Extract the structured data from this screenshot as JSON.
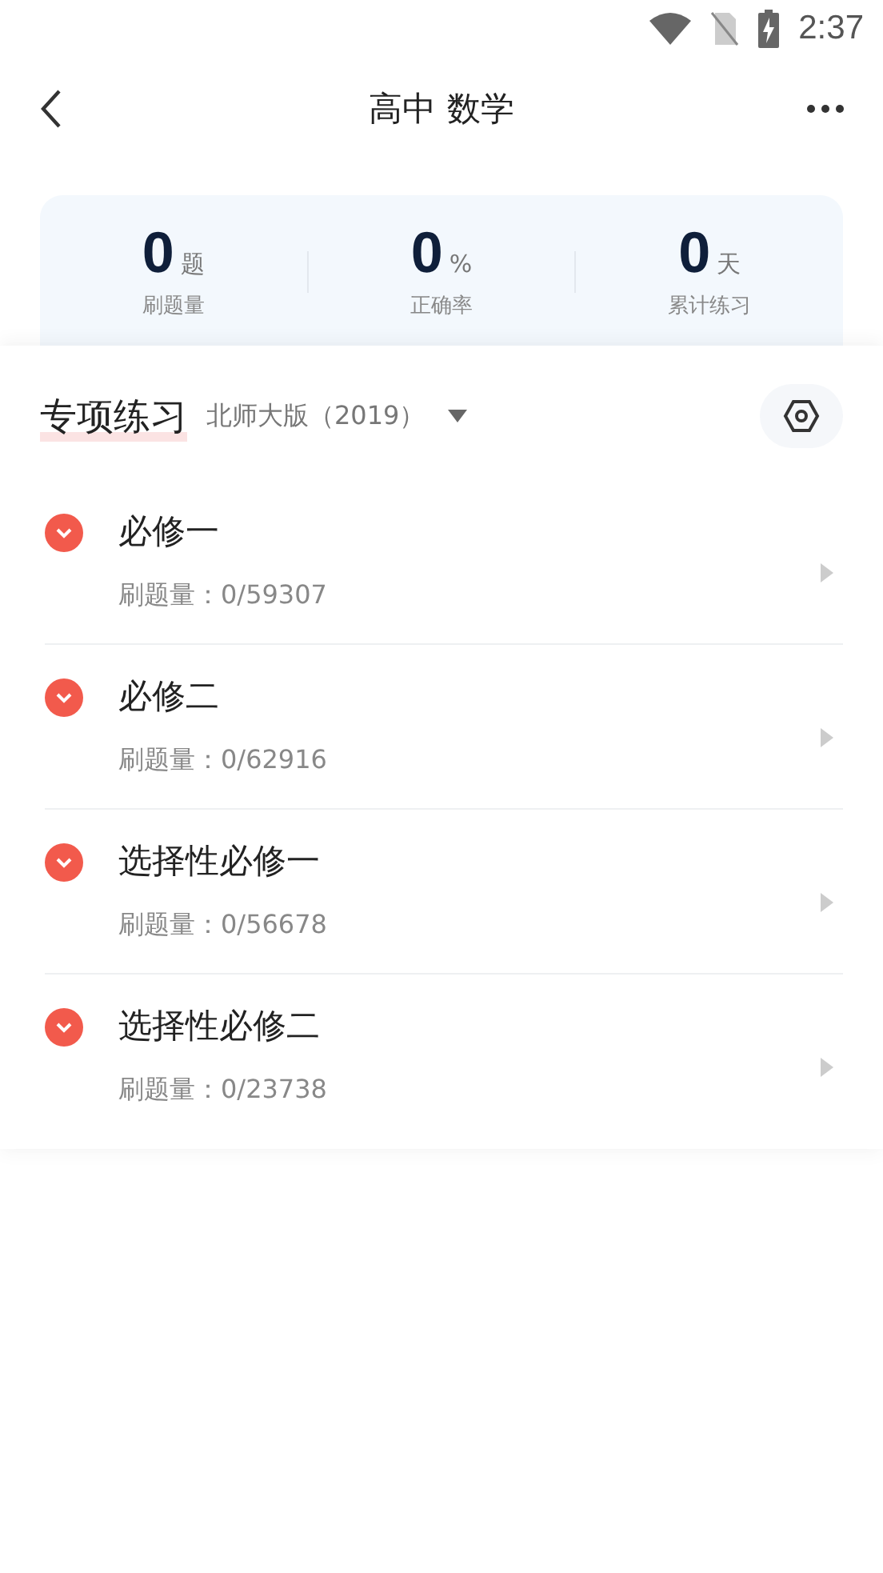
{
  "status_bar": {
    "time": "2:37"
  },
  "nav": {
    "title": "高中 数学"
  },
  "stats": [
    {
      "value": "0",
      "unit": "题",
      "label": "刷题量"
    },
    {
      "value": "0",
      "unit": "%",
      "label": "正确率"
    },
    {
      "value": "0",
      "unit": "天",
      "label": "累计练习"
    }
  ],
  "section": {
    "title": "专项练习",
    "edition": "北师大版（2019）"
  },
  "items": [
    {
      "title": "必修一",
      "count": "刷题量：0/59307"
    },
    {
      "title": "必修二",
      "count": "刷题量：0/62916"
    },
    {
      "title": "选择性必修一",
      "count": "刷题量：0/56678"
    },
    {
      "title": "选择性必修二",
      "count": "刷题量：0/23738"
    }
  ]
}
